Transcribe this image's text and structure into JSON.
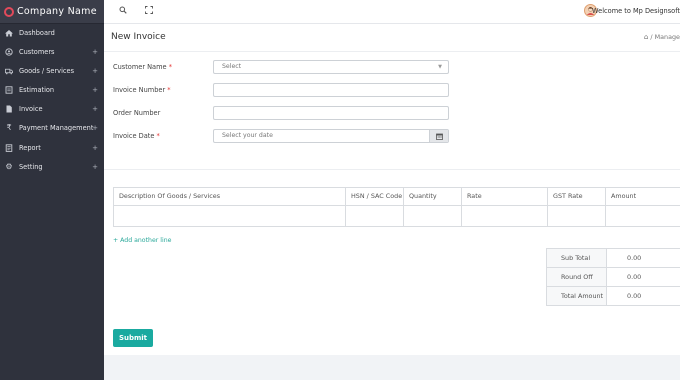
{
  "app": {
    "company_name": "Company  Name"
  },
  "sidebar": {
    "items": [
      {
        "label": "Dashboard",
        "icon": "dashboard-icon",
        "plus": ""
      },
      {
        "label": "Customers",
        "icon": "customers-icon",
        "plus": "+"
      },
      {
        "label": "Goods / Services",
        "icon": "goods-icon",
        "plus": "+"
      },
      {
        "label": "Estimation",
        "icon": "estimation-icon",
        "plus": "+"
      },
      {
        "label": "Invoice",
        "icon": "invoice-icon",
        "plus": "+"
      },
      {
        "label": "Payment Management",
        "icon": "rupee-icon",
        "plus": "+"
      },
      {
        "label": "Report",
        "icon": "report-icon",
        "plus": "+"
      },
      {
        "label": "Setting",
        "icon": "gear-icon",
        "plus": "+"
      }
    ]
  },
  "topbar": {
    "welcome": "Welcome to Mp Designsoft"
  },
  "page": {
    "title": "New Invoice",
    "breadcrumb": "/  Manage"
  },
  "form": {
    "customer_name_label": "Customer Name",
    "customer_name_value": "Select",
    "invoice_number_label": "Invoice Number",
    "order_number_label": "Order Number",
    "invoice_date_label": "Invoice Date",
    "invoice_date_placeholder": "Select your date",
    "required_mark": "*"
  },
  "table": {
    "headers": [
      "Description Of Goods / Services",
      "HSN / SAC Code",
      "Quantity",
      "Rate",
      "GST Rate",
      "Amount"
    ]
  },
  "add_line": "+ Add another line",
  "totals": [
    {
      "label": "Sub Total",
      "value": "0.00"
    },
    {
      "label": "Round Off",
      "value": "0.00"
    },
    {
      "label": "Total Amount",
      "value": "0.00"
    }
  ],
  "submit_label": "Submit"
}
